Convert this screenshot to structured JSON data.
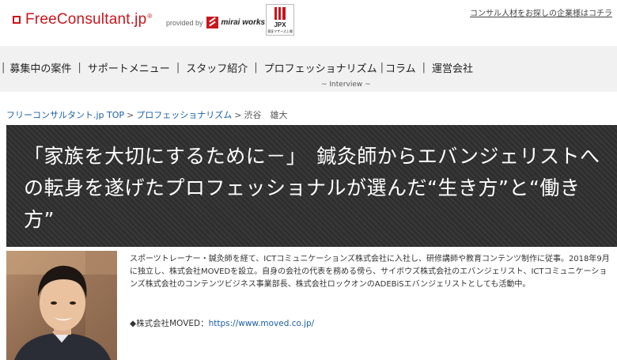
{
  "header": {
    "logo_text": "FreeConsultant",
    "logo_suffix": ".jp",
    "logo_reg": "®",
    "provided_by": "provided by",
    "provider_name": "mirai works",
    "jpx_label": "JPX",
    "jpx_sub": "東証マザーズ上場",
    "corporate_link": "コンサル人材をお探しの企業様はコチラ"
  },
  "nav": {
    "items": [
      {
        "label": "募集中の案件"
      },
      {
        "label": "サポートメニュー"
      },
      {
        "label": "スタッフ紹介"
      },
      {
        "label": "プロフェッショナリズム"
      },
      {
        "label": "コラム"
      },
      {
        "label": "運営会社"
      }
    ],
    "separator": "|",
    "sub_label": "~ Interview ~"
  },
  "breadcrumb": {
    "home": "フリーコンサルタント.jp TOP",
    "section": "プロフェッショナリズム",
    "current": "渋谷　雄大",
    "separator": ">"
  },
  "banner": {
    "title": "「家族を大切にするために－」　鍼灸師からエバンジェリストへの転身を遂げたプロフェッショナルが選んだ“生き方”と“働き方”"
  },
  "profile": {
    "bio": "スポーツトレーナー・鍼灸師を経て、ICTコミュニケーションズ株式会社に入社し、研修講師や教育コンテンツ制作に従事。2018年9月に独立し、株式会社MOVEDを設立。自身の会社の代表を務める傍ら、サイボウズ株式会社のエバンジェリスト、ICTコミュニケーションズ株式会社のコンテンツビジネス事業部長、株式会社ロックオンのADEBiSエバンジェリストとしても活動中。",
    "company_label": "◆株式会社MOVED：",
    "company_url": "https://www.moved.co.jp/"
  },
  "colors": {
    "brand_red": "#c8161d",
    "link_blue": "#1a5fa8",
    "nav_bg": "#f1f1f1",
    "banner_bg": "#2e2e2e"
  }
}
